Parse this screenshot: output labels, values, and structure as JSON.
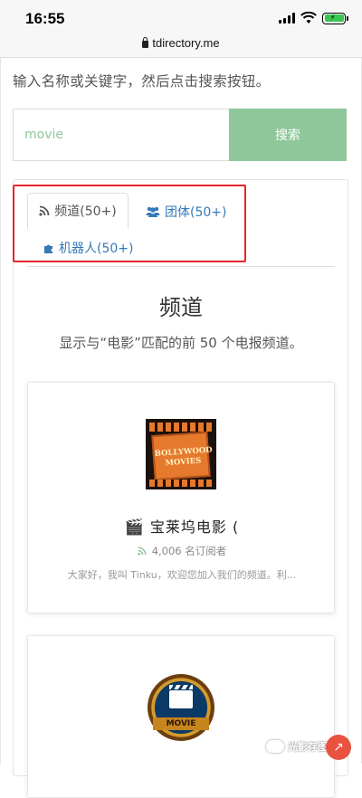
{
  "status_bar": {
    "time": "16:55"
  },
  "browser": {
    "url": "tdirectory.me"
  },
  "instruction": "输入名称或关键字，然后点击搜索按钮。",
  "search": {
    "value": "movie",
    "button_label": "搜索"
  },
  "tabs": [
    {
      "label": "频道(50+)",
      "icon": "rss-icon",
      "active": true
    },
    {
      "label": "团体(50+)",
      "icon": "users-icon",
      "active": false
    },
    {
      "label": "机器人(50+)",
      "icon": "puzzle-icon",
      "active": false
    }
  ],
  "section": {
    "title": "频道",
    "description": "显示与“电影”匹配的前 50 个电报频道。"
  },
  "cards": [
    {
      "thumbnail_text": "BOLLYWOOD MOVIES",
      "name": "宝莱坞电影 (",
      "name_icon": "🎬",
      "subscribers": "4,006 名订阅者",
      "description": "大家好，我叫 Tinku，欢迎您加入我们的频道。利..."
    },
    {
      "thumbnail_text": "MOVIE"
    }
  ],
  "watermark": {
    "text": "光影存图"
  },
  "colors": {
    "accent_green": "#8fc79b",
    "link_blue": "#337ab7",
    "highlight_red": "#e5262a"
  }
}
